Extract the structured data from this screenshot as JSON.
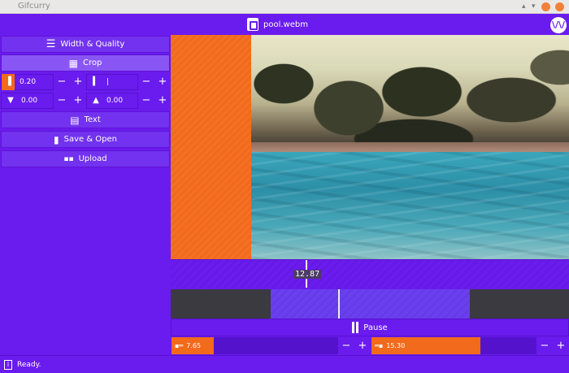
{
  "window": {
    "title": "Gifcurry"
  },
  "header": {
    "file_name": "pool.webm",
    "logo_text": "\\/\\/"
  },
  "sidebar": {
    "width_quality_label": "Width & Quality",
    "crop_label": "Crop",
    "left_crop_value": "0.20",
    "right_crop_value": "|",
    "top_crop_value": "0.00",
    "bottom_crop_value": "0.00",
    "text_label": "Text",
    "save_open_label": "Save & Open",
    "upload_label": "Upload"
  },
  "timeline": {
    "current_time": "12.87"
  },
  "playback": {
    "pause_label": "Pause"
  },
  "range": {
    "start_value": "7.65",
    "end_value": "15.30"
  },
  "status": {
    "text": "Ready."
  },
  "colors": {
    "brand": "#6a1bee",
    "accent": "#f26a1b"
  }
}
